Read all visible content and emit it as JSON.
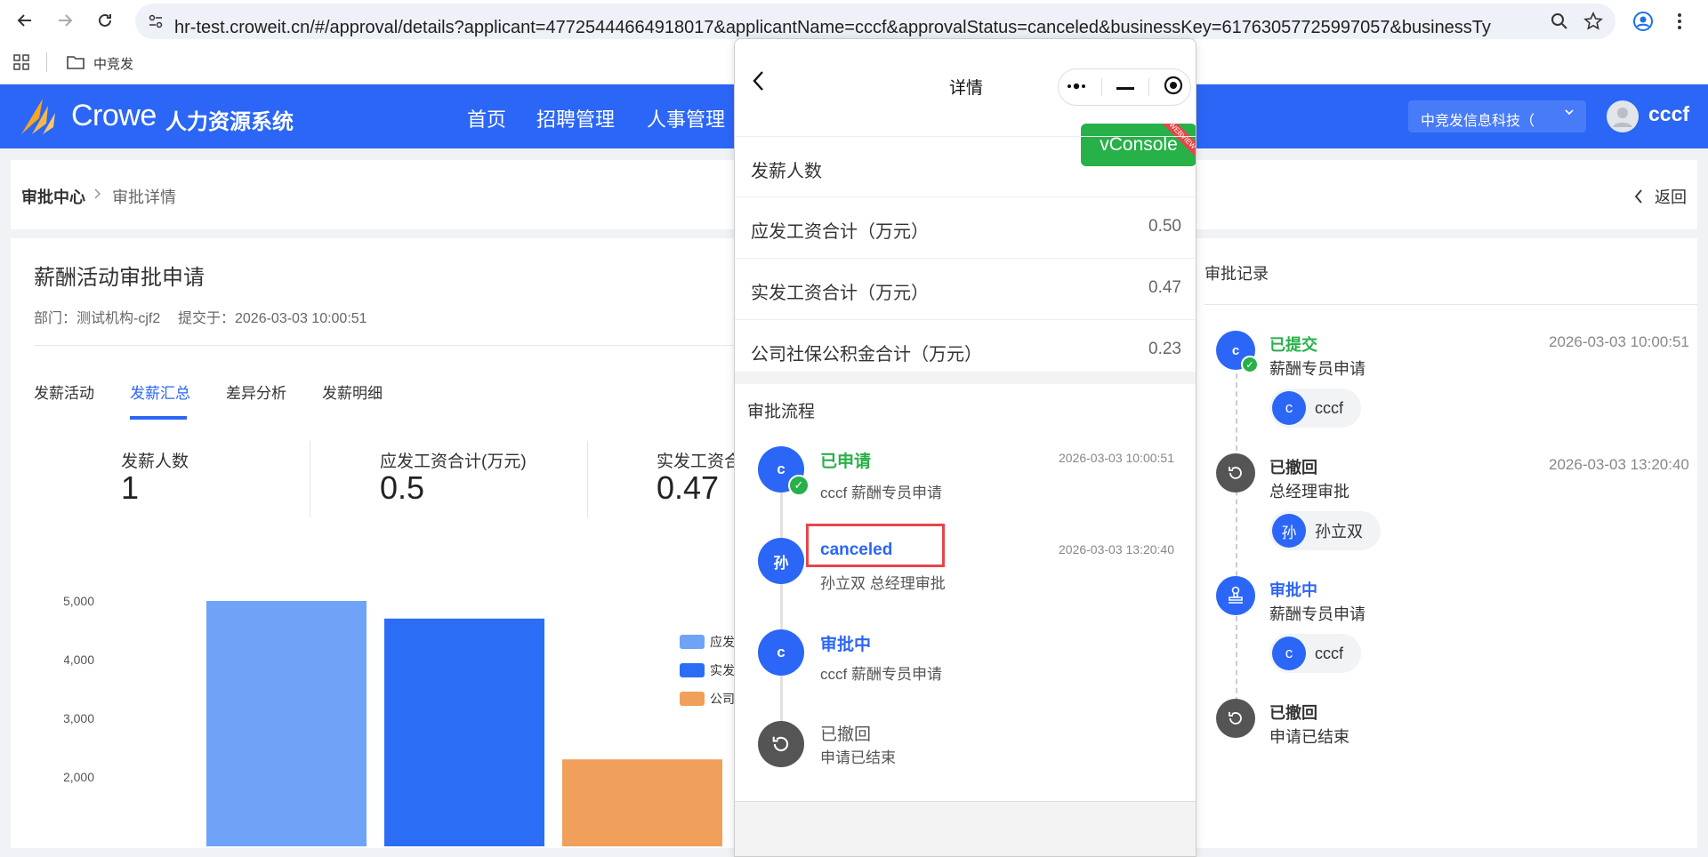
{
  "browser": {
    "url": "hr-test.croweit.cn/#/approval/details?applicant=47725444664918017&applicantName=cccf&approvalStatus=canceled&businessKey=61763057725997057&businessType=薪酬活动...",
    "bookmark": "中竞发"
  },
  "header": {
    "brand": "Crowe",
    "system_name": "人力资源系统",
    "menu": [
      "首页",
      "招聘管理",
      "人事管理"
    ],
    "company": "中竞发信息科技（",
    "user": "cccf"
  },
  "breadcrumb": {
    "root": "审批中心",
    "current": "审批详情",
    "back": "返回"
  },
  "main": {
    "title": "薪酬活动审批申请",
    "department": "部门：测试机构-cjf2",
    "submitted": "提交于：2026-03-03 10:00:51",
    "tabs": [
      "发薪活动",
      "发薪汇总",
      "差异分析",
      "发薪明细"
    ],
    "active_tab": "发薪汇总",
    "stats": [
      {
        "label": "发薪人数",
        "value": "1"
      },
      {
        "label": "应发工资合计(万元)",
        "value": "0.5"
      },
      {
        "label": "实发工资合",
        "value": "0.47"
      }
    ]
  },
  "chart_data": {
    "type": "bar",
    "categories": [
      "应发",
      "实发",
      "公司"
    ],
    "values": [
      5000,
      4700,
      2300
    ],
    "colors": [
      "#6ea3f7",
      "#2b6ef5",
      "#f0a05a"
    ],
    "legend": [
      "应发",
      "实发",
      "公司"
    ],
    "yticks": [
      "5,000",
      "4,000",
      "3,000",
      "2,000"
    ],
    "ylim": [
      2000,
      5000
    ]
  },
  "records": {
    "title": "审批记录",
    "items": [
      {
        "avatar": "c",
        "status": "已提交",
        "desc": "薪酬专员申请",
        "time": "2026-03-03 10:00:51",
        "chip_avatar": "c",
        "chip_name": "cccf",
        "color": "#27b148"
      },
      {
        "avatar": "↺",
        "status": "已撤回",
        "desc": "总经理审批",
        "time": "2026-03-03 13:20:40",
        "chip_avatar": "孙",
        "chip_name": "孙立双",
        "color": "#333333"
      },
      {
        "avatar": "stamp",
        "status": "审批中",
        "desc": "薪酬专员申请",
        "time": "",
        "chip_avatar": "c",
        "chip_name": "cccf",
        "color": "#2b66f6"
      },
      {
        "avatar": "↺",
        "status": "已撤回",
        "desc": "申请已结束",
        "time": "",
        "chip_avatar": "",
        "chip_name": "",
        "color": "#333333"
      }
    ]
  },
  "phone": {
    "title": "详情",
    "vconsole": "vConsole",
    "vconsole_ribbon": "WEBVIEW",
    "rows": [
      {
        "label": "发薪人数",
        "value": ""
      },
      {
        "label": "应发工资合计（万元）",
        "value": "0.50"
      },
      {
        "label": "实发工资合计（万元）",
        "value": "0.47"
      },
      {
        "label": "公司社保公积金合计（万元）",
        "value": "0.23"
      }
    ],
    "flow_title": "审批流程",
    "flow": [
      {
        "avatar": "c",
        "status": "已申请",
        "desc": "cccf 薪酬专员申请",
        "time": "2026-03-03 10:00:51",
        "color": "#27b148"
      },
      {
        "avatar": "孙",
        "status": "canceled",
        "desc": "孙立双 总经理审批",
        "time": "2026-03-03 13:20:40",
        "color": "#2b66f6"
      },
      {
        "avatar": "c",
        "status": "审批中",
        "desc": "cccf 薪酬专员申请",
        "time": "",
        "color": "#2b66f6"
      },
      {
        "avatar": "↺",
        "status": "已撤回",
        "desc": "申请已结束",
        "time": "",
        "color": "#555555"
      }
    ]
  }
}
